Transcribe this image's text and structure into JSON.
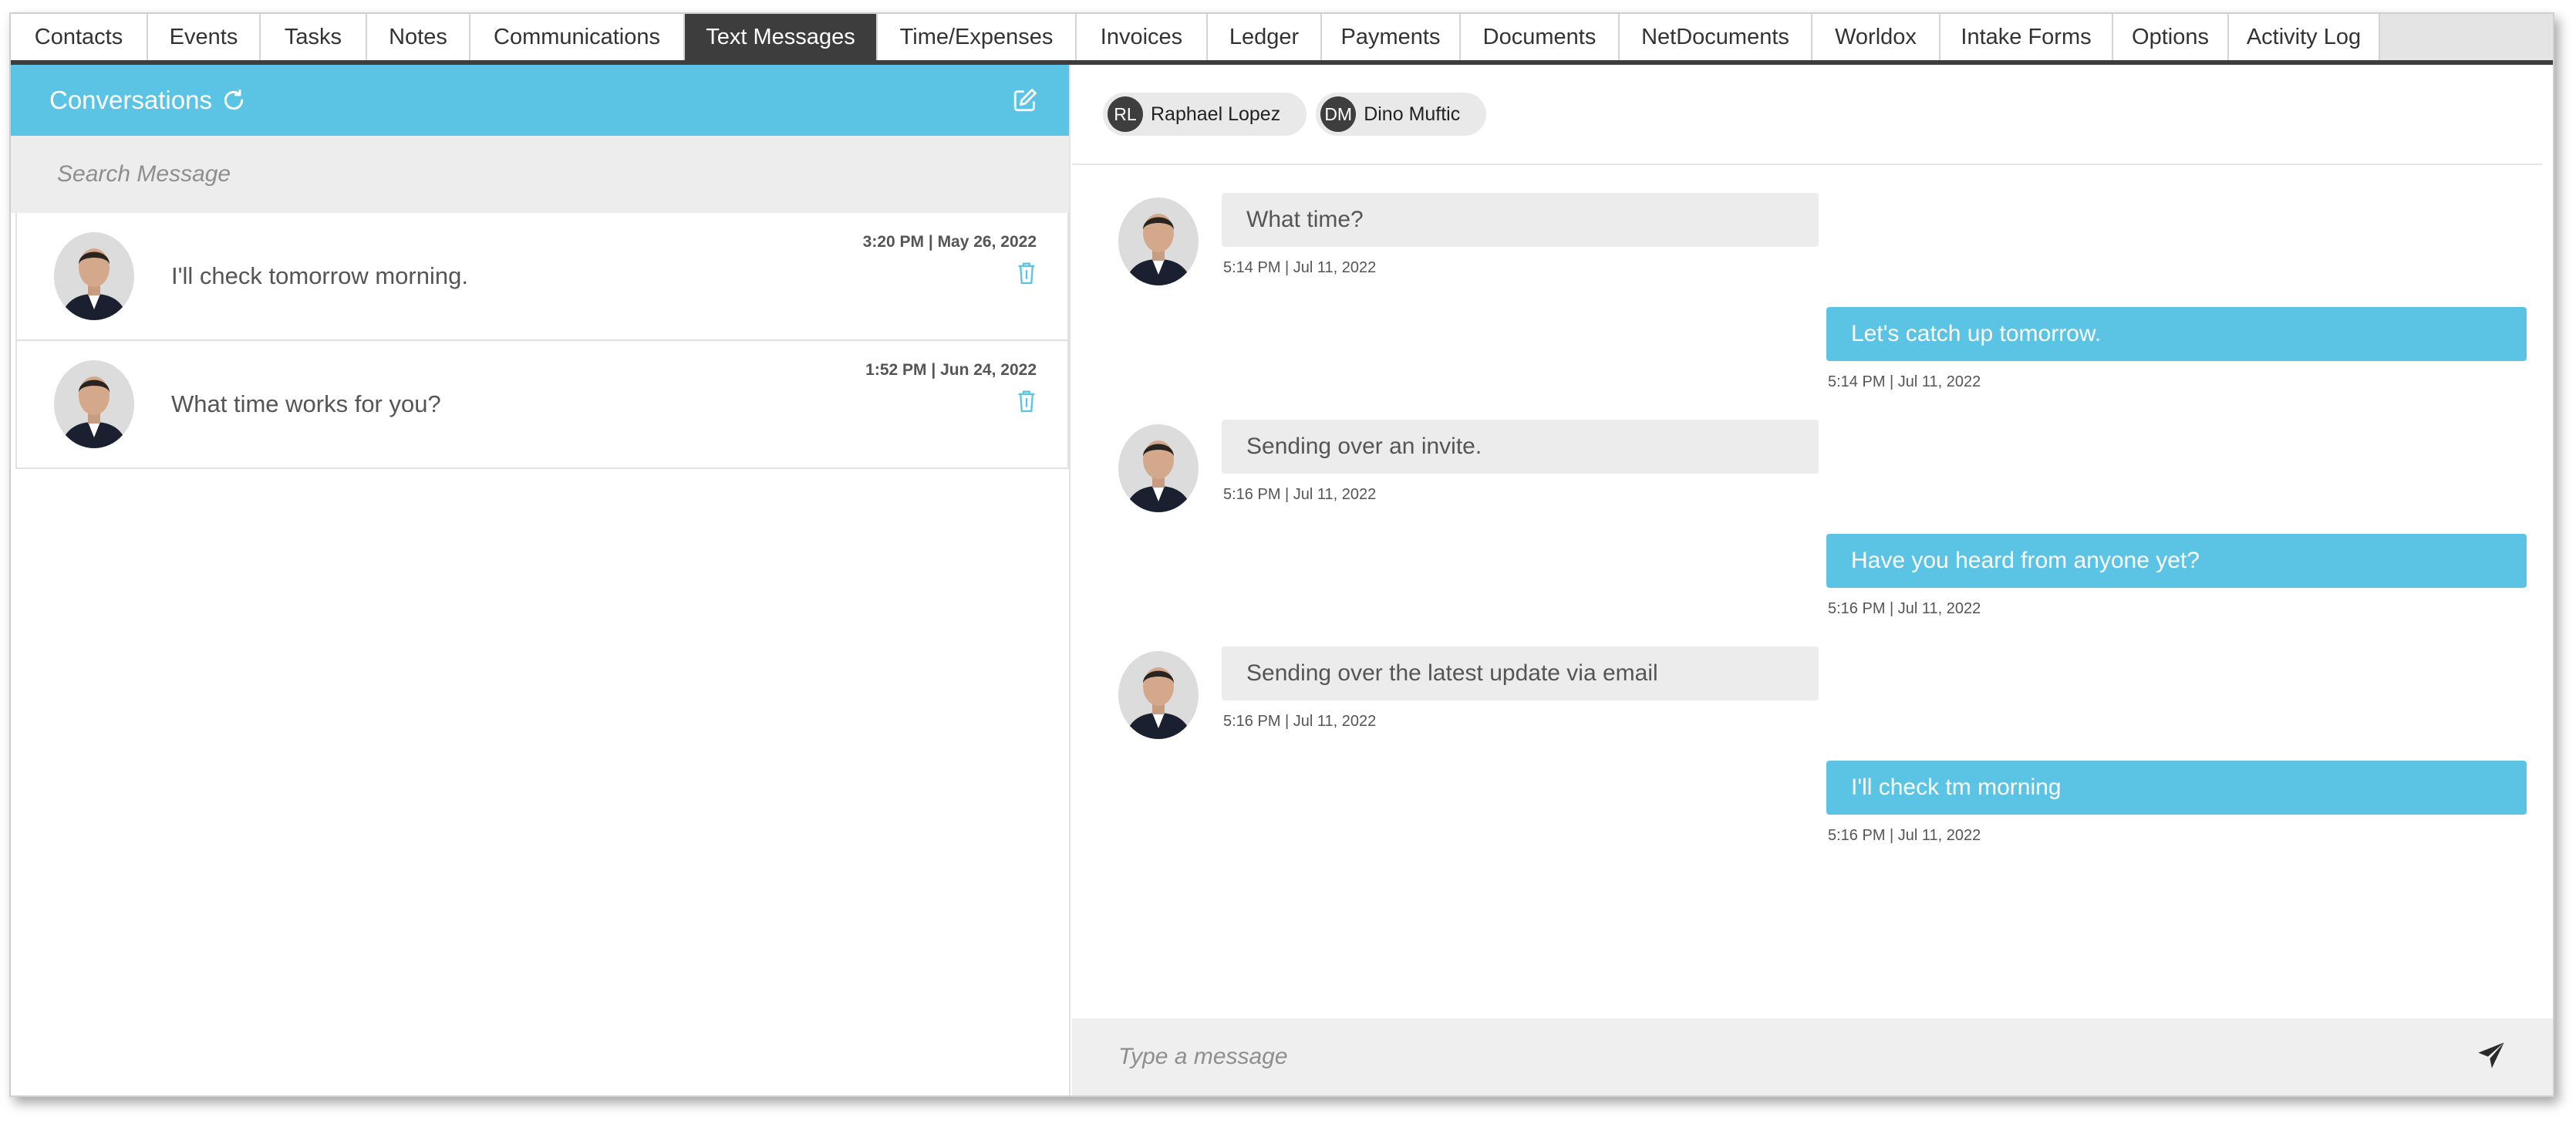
{
  "tabs": [
    {
      "label": "Contacts",
      "active": false
    },
    {
      "label": "Events",
      "active": false
    },
    {
      "label": "Tasks",
      "active": false
    },
    {
      "label": "Notes",
      "active": false
    },
    {
      "label": "Communications",
      "active": false
    },
    {
      "label": "Text Messages",
      "active": true
    },
    {
      "label": "Time/Expenses",
      "active": false
    },
    {
      "label": "Invoices",
      "active": false
    },
    {
      "label": "Ledger",
      "active": false
    },
    {
      "label": "Payments",
      "active": false
    },
    {
      "label": "Documents",
      "active": false
    },
    {
      "label": "NetDocuments",
      "active": false
    },
    {
      "label": "Worldox",
      "active": false
    },
    {
      "label": "Intake Forms",
      "active": false
    },
    {
      "label": "Options",
      "active": false
    },
    {
      "label": "Activity Log",
      "active": false
    }
  ],
  "conversations": {
    "title": "Conversations",
    "search_placeholder": "Search Message",
    "items": [
      {
        "preview": "I'll check tomorrow morning.",
        "time": "3:20 PM | May 26, 2022"
      },
      {
        "preview": "What time works for you?",
        "time": "1:52 PM | Jun 24, 2022"
      }
    ]
  },
  "chat": {
    "participants": [
      {
        "initials": "RL",
        "name": "Raphael Lopez"
      },
      {
        "initials": "DM",
        "name": "Dino Muftic"
      }
    ],
    "messages": [
      {
        "direction": "in",
        "text": "What time?",
        "time": "5:14 PM | Jul 11, 2022"
      },
      {
        "direction": "out",
        "text": "Let's catch up tomorrow.",
        "time": "5:14 PM | Jul 11, 2022"
      },
      {
        "direction": "in",
        "text": "Sending over an invite.",
        "time": "5:16 PM | Jul 11, 2022"
      },
      {
        "direction": "out",
        "text": "Have you heard from anyone yet?",
        "time": "5:16 PM | Jul 11, 2022"
      },
      {
        "direction": "in",
        "text": "Sending over the latest update via email",
        "time": "5:16 PM | Jul 11, 2022"
      },
      {
        "direction": "out",
        "text": "I'll check tm morning",
        "time": "5:16 PM | Jul 11, 2022"
      }
    ],
    "input_placeholder": "Type a message"
  },
  "colors": {
    "accent": "#5bc4e4",
    "active_tab": "#3d3d3d",
    "incoming_bubble": "#ececec"
  },
  "icons": {
    "refresh": "refresh-icon",
    "compose": "compose-icon",
    "trash": "trash-icon",
    "send": "send-icon",
    "avatar": "avatar-photo"
  }
}
